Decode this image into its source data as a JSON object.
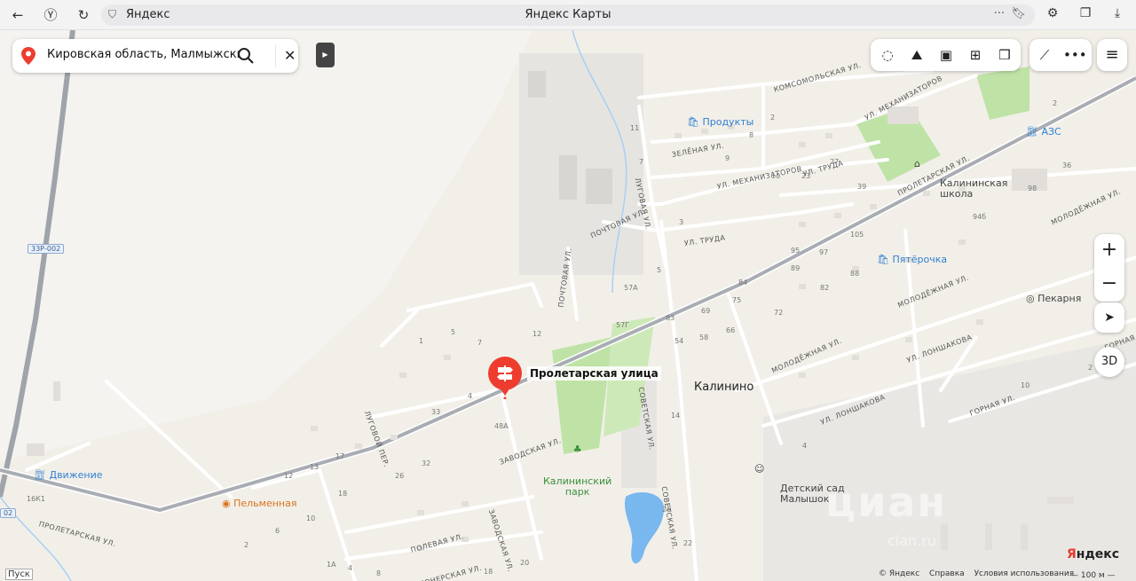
{
  "browser": {
    "host": "Яндекс",
    "title": "Яндекс Карты"
  },
  "search": {
    "query": "Кировская область, Малмыжский ра"
  },
  "place": {
    "marker_label": "Пролетарская улица",
    "village": "Калинино"
  },
  "pois": {
    "produkty": "Продукты",
    "azs": "АЗС",
    "school": "Калининская\nшкола",
    "pyaterochka": "Пятёрочка",
    "bakery": "Пекарня",
    "park": "Калининский\nпарк",
    "kindergarten": "Детский сад\nМалышок",
    "dvizhenie": "Движение",
    "pelmennaya": "Пельменная"
  },
  "streets": {
    "komsomolskaya": "КОМСОМОЛЬСКАЯ УЛ.",
    "mekhanizatorov_top": "УЛ. МЕХАНИЗАТОРОВ",
    "mekhanizatorov": "УЛ. МЕХАНИЗАТОРОВ",
    "zelenaya": "ЗЕЛЁНАЯ УЛ.",
    "lugovaya": "ЛУГОВАЯ УЛ.",
    "truda_top": "УЛ. ТРУДА",
    "truda": "УЛ. ТРУДА",
    "proletarskaya_main": "ПРОЛЕТАРСКАЯ УЛ.",
    "proletarskaya_left": "ПРОЛЕТАРСКАЯ УЛ.",
    "pochtovaya_diag": "ПОЧТОВАЯ УЛ.",
    "pochtovaya_vert": "ПОЧТОВАЯ УЛ.",
    "molodezhnaya_top": "МОЛОДЁЖНАЯ УЛ.",
    "molodezhnaya_mid": "МОЛОДЁЖНАЯ УЛ.",
    "molodezhnaya_low": "МОЛОДЁЖНАЯ УЛ.",
    "lonshakova_1": "УЛ. ЛОНШАКОВА",
    "lonshakova_2": "УЛ. ЛОНШАКОВА",
    "gornaya_1": "ГОРНАЯ УЛ.",
    "gornaya_2": "ГОРНАЯ",
    "sovetskaya_1": "СОВЕТСКАЯ УЛ.",
    "sovetskaya_2": "СОВЕТСКАЯ УЛ.",
    "lugovoy_per": "ЛУГОВОЙ ПЕР.",
    "zavodskaya_1": "ЗАВОДСКАЯ УЛ.",
    "zavodskaya_2": "ЗАВОДСКАЯ УЛ.",
    "polevaya": "ПОЛЕВАЯ УЛ.",
    "pionerskaya": "ПИОНЕРСКАЯ УЛ."
  },
  "roads": {
    "r1": "33Р-002",
    "r2": "02"
  },
  "houses": [
    "2",
    "11",
    "7",
    "9",
    "8",
    "10",
    "23",
    "27",
    "39",
    "3",
    "5",
    "2",
    "36",
    "98",
    "94б",
    "105",
    "97",
    "88",
    "84",
    "82",
    "89",
    "95",
    "57А",
    "57Г",
    "83",
    "69",
    "75",
    "72",
    "54",
    "58",
    "66",
    "1",
    "5",
    "7",
    "12",
    "4",
    "48А",
    "33",
    "32",
    "26",
    "17",
    "13",
    "12",
    "18",
    "16К1",
    "10",
    "6",
    "2",
    "1А",
    "4",
    "8",
    "18",
    "20",
    "26",
    "22",
    "14",
    "10",
    "4",
    "2"
  ],
  "controls": {
    "zoom_in": "+",
    "zoom_out": "−",
    "three_d": "3D",
    "start": "Пуск"
  },
  "footer": {
    "copyright": "© Яндекс",
    "help": "Справка",
    "terms": "Условия использования",
    "scale": "100 м",
    "logo_red": "Я",
    "logo_rest": "ндекс"
  },
  "watermark": {
    "main": "циан",
    "sub": "cian.ru"
  },
  "colors": {
    "marker": "#ee3d2f",
    "main_road": "#9fa3aa",
    "park": "#bfe3a6",
    "water": "#79b7ef",
    "background": "#f2efe9"
  }
}
